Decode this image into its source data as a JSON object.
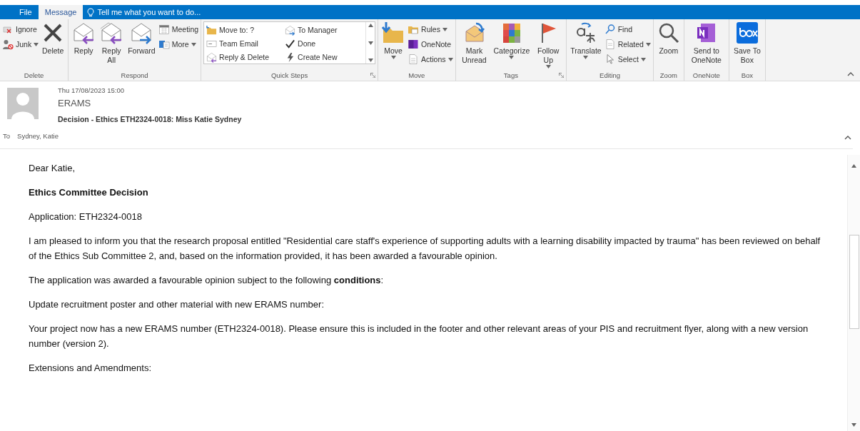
{
  "tabs": [
    {
      "label": "File",
      "selected": false
    },
    {
      "label": "Message",
      "selected": true
    }
  ],
  "tell_me": {
    "placeholder": "Tell me what you want to do..."
  },
  "ribbon": {
    "groups": [
      {
        "label": "Delete",
        "launcher": false,
        "columns": [
          {
            "kind": "stack",
            "items": [
              {
                "label": "Ignore",
                "dropdown": false
              },
              {
                "label": "Junk",
                "dropdown": true
              }
            ]
          },
          {
            "kind": "large",
            "label": "Delete",
            "dropdown": false
          }
        ]
      },
      {
        "label": "Respond",
        "launcher": false,
        "columns": [
          {
            "kind": "large",
            "label": "Reply",
            "dropdown": false
          },
          {
            "kind": "large",
            "label": "Reply All",
            "dropdown": false
          },
          {
            "kind": "large",
            "label": "Forward",
            "dropdown": false
          },
          {
            "kind": "stack",
            "items": [
              {
                "label": "Meeting",
                "dropdown": false
              },
              {
                "label": "More",
                "dropdown": true
              }
            ]
          }
        ]
      },
      {
        "label": "Quick Steps",
        "launcher": true,
        "columns": [
          {
            "kind": "gallery",
            "items": [
              {
                "label": "Move to: ?"
              },
              {
                "label": "Team Email"
              },
              {
                "label": "Reply & Delete"
              },
              {
                "label": "To Manager"
              },
              {
                "label": "Done"
              },
              {
                "label": "Create New"
              }
            ]
          }
        ]
      },
      {
        "label": "Move",
        "launcher": false,
        "columns": [
          {
            "kind": "large",
            "label": "Move",
            "dropdown": true
          },
          {
            "kind": "stack",
            "items": [
              {
                "label": "Rules",
                "dropdown": true
              },
              {
                "label": "OneNote",
                "dropdown": false
              },
              {
                "label": "Actions",
                "dropdown": true
              }
            ]
          }
        ]
      },
      {
        "label": "Tags",
        "launcher": true,
        "columns": [
          {
            "kind": "large",
            "label": "Mark Unread",
            "dropdown": false
          },
          {
            "kind": "large",
            "label": "Categorize",
            "dropdown": true
          },
          {
            "kind": "large",
            "label": "Follow Up",
            "dropdown": true
          }
        ]
      },
      {
        "label": "Editing",
        "launcher": false,
        "columns": [
          {
            "kind": "large",
            "label": "Translate",
            "dropdown": true
          },
          {
            "kind": "stack",
            "items": [
              {
                "label": "Find",
                "dropdown": false
              },
              {
                "label": "Related",
                "dropdown": true
              },
              {
                "label": "Select",
                "dropdown": true
              }
            ]
          }
        ]
      },
      {
        "label": "Zoom",
        "launcher": false,
        "columns": [
          {
            "kind": "large",
            "label": "Zoom",
            "dropdown": false
          }
        ]
      },
      {
        "label": "OneNote",
        "launcher": false,
        "columns": [
          {
            "kind": "large",
            "label": "Send to OneNote",
            "dropdown": false
          }
        ]
      },
      {
        "label": "Box",
        "launcher": false,
        "columns": [
          {
            "kind": "large",
            "label": "Save To Box",
            "dropdown": false
          }
        ]
      }
    ]
  },
  "message": {
    "date": "Thu 17/08/2023 15:00",
    "sender": "ERAMS",
    "subject": "Decision - Ethics ETH2324-0018: Miss Katie Sydney",
    "to_label": "To",
    "to": "Sydney, Katie"
  },
  "body": [
    {
      "kind": "text",
      "text": "Dear Katie,"
    },
    {
      "kind": "heading",
      "text": "Ethics Committee Decision"
    },
    {
      "kind": "text",
      "text": "Application: ETH2324-0018"
    },
    {
      "kind": "text",
      "text": "I am pleased to inform you that the research proposal entitled \"Residential care staff's experience of supporting adults with a learning disability impacted by trauma\" has been reviewed on behalf of the Ethics Sub Committee 2, and, based on the information provided, it has been awarded a favourable opinion."
    },
    {
      "kind": "text",
      "text": "The application was awarded a favourable opinion subject to the following **conditions**:"
    },
    {
      "kind": "text",
      "text": "Update recruitment poster and other material with new ERAMS number:"
    },
    {
      "kind": "text",
      "text": "Your project now has a new ERAMS number (ETH2324-0018). Please ensure this is included in the footer and other relevant areas of your PIS and recruitment flyer, along with a new version number (version 2)."
    },
    {
      "kind": "text",
      "text": "Extensions and Amendments:"
    }
  ]
}
